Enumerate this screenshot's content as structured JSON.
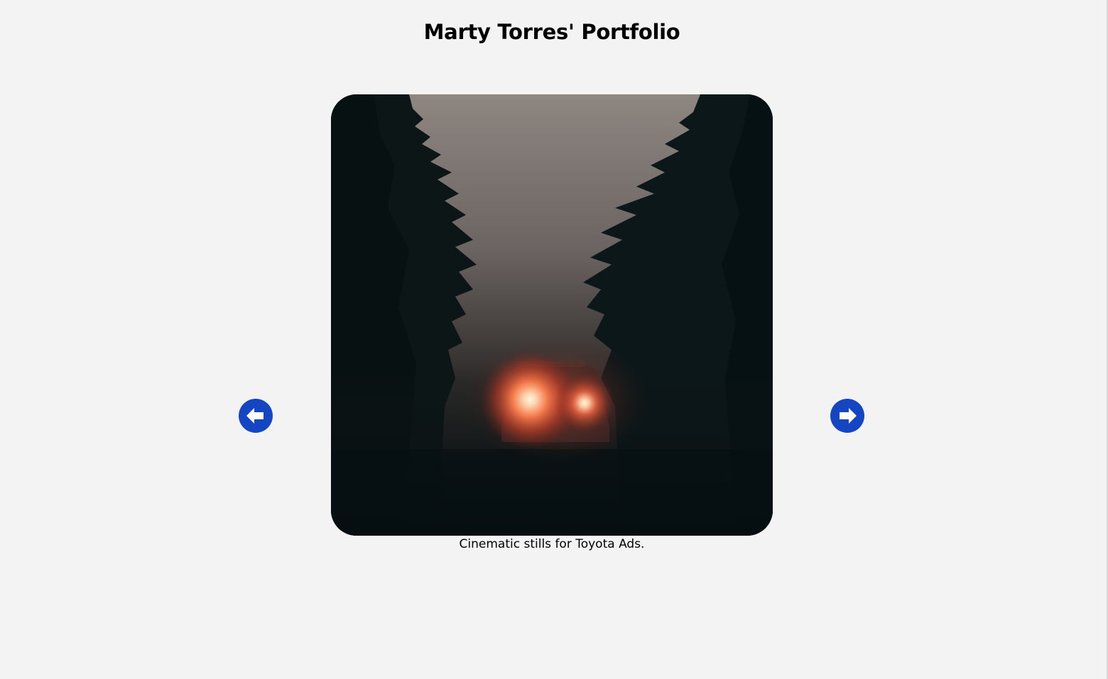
{
  "header": {
    "title": "Marty Torres' Portfolio"
  },
  "slideshow": {
    "current_slide": {
      "image_subject": "car with glowing headlights on a foggy forest road",
      "caption": "Cinematic stills for Toyota Ads."
    },
    "prev_icon": "arrow-circle-left-icon",
    "next_icon": "arrow-circle-right-icon"
  },
  "colors": {
    "background": "#f3f3f3",
    "arrow_accent": "#1446c4",
    "text": "#000000"
  }
}
